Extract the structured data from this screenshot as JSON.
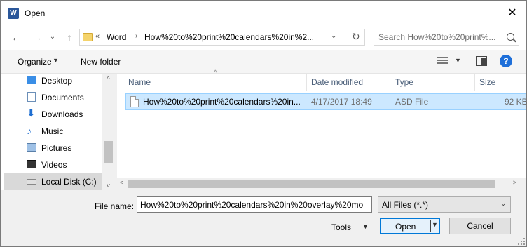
{
  "window": {
    "title": "Open",
    "close_glyph": "✕"
  },
  "nav": {
    "back": "←",
    "forward": "→",
    "recent": "⌄",
    "up": "↑",
    "breadcrumb_overflow": "«",
    "breadcrumb": [
      "Word",
      "How%20to%20print%20calendars%20in%2..."
    ],
    "crumb_arrow": "›",
    "dropdown": "⌄",
    "refresh": "↻",
    "search_placeholder": "Search How%20to%20print%..."
  },
  "toolbar": {
    "organize_label": "Organize",
    "new_folder_label": "New folder",
    "dropdown_arrow": "▼",
    "help": "?"
  },
  "sidebar": {
    "items": [
      {
        "label": "Desktop",
        "icon": "desktop-icon"
      },
      {
        "label": "Documents",
        "icon": "documents-icon"
      },
      {
        "label": "Downloads",
        "icon": "downloads-icon"
      },
      {
        "label": "Music",
        "icon": "music-icon"
      },
      {
        "label": "Pictures",
        "icon": "pictures-icon"
      },
      {
        "label": "Videos",
        "icon": "videos-icon"
      },
      {
        "label": "Local Disk (C:)",
        "icon": "local-disk-icon",
        "selected": true
      }
    ],
    "scroll_up": "^",
    "scroll_down": "v"
  },
  "filelist": {
    "columns": [
      "Name",
      "Date modified",
      "Type",
      "Size"
    ],
    "sort_caret": "^",
    "rows": [
      {
        "name": "How%20to%20print%20calendars%20in...",
        "date": "4/17/2017 18:49",
        "type": "ASD File",
        "size": "92 KB",
        "selected": true
      }
    ],
    "scroll_left": "<",
    "scroll_right": ">"
  },
  "bottom": {
    "file_name_label": "File name:",
    "file_name_value": "How%20to%20print%20calendars%20in%20overlay%20mo",
    "filter_value": "All Files (*.*)",
    "filter_arrow": "⌄",
    "tools_label": "Tools",
    "tools_arrow": "▼",
    "open_label": "Open",
    "open_arrow": "▼",
    "cancel_label": "Cancel"
  },
  "colors": {
    "selection_bg": "#cce8ff",
    "accent": "#0078d7",
    "header_text": "#4c607a"
  }
}
